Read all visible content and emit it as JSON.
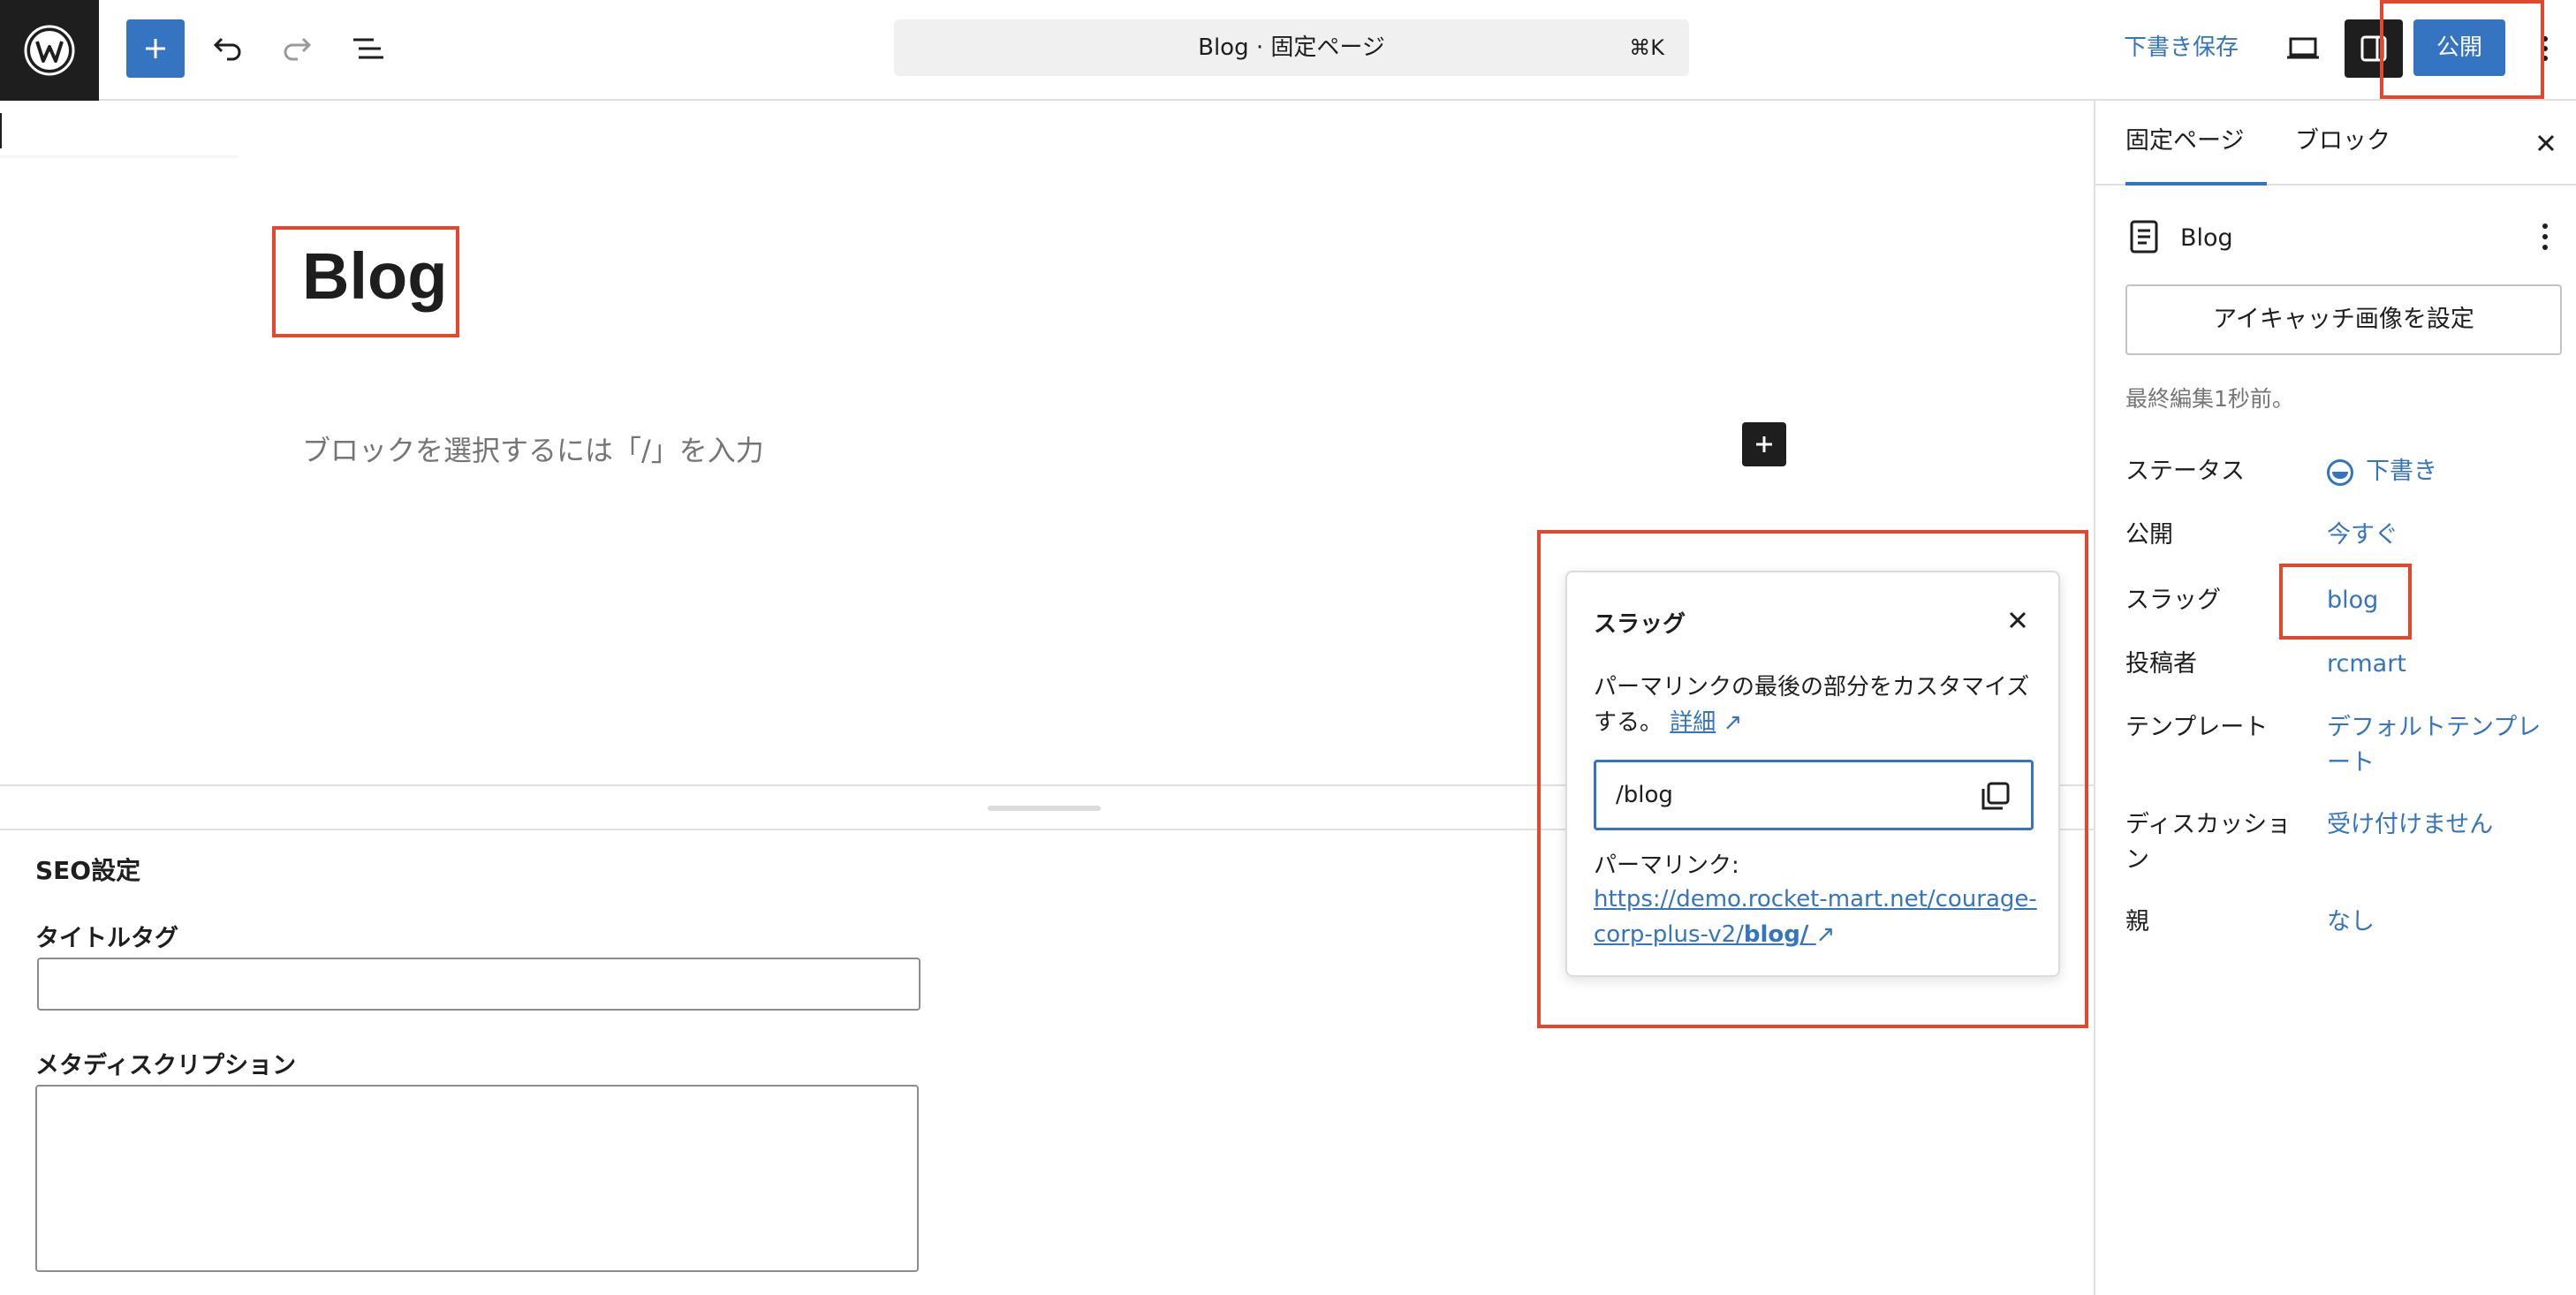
{
  "topbar": {
    "logo": "wordpress-logo",
    "icons": [
      "plus-icon",
      "undo-icon",
      "redo-icon",
      "document-overview-icon",
      "preview-icon",
      "settings-sidebar-icon",
      "more-vertical-icon"
    ],
    "document_title": "Blog · 固定ページ",
    "shortcut": "⌘K",
    "save_draft": "下書き保存",
    "publish": "公開"
  },
  "editor": {
    "title": "Blog",
    "placeholder": "ブロックを選択するには「/」を入力"
  },
  "slug_popover": {
    "title": "スラッグ",
    "description": "パーマリンクの最後の部分をカスタマイズする。",
    "learn_more": "詳細",
    "slug_value": "/blog",
    "permalink_label": "パーマリンク:",
    "permalink_base": "https://demo.rocket-mart.net/courage-corp-plus-v2/",
    "permalink_slug": "blog/"
  },
  "seo": {
    "title": "SEO設定",
    "title_tag_label": "タイトルタグ",
    "title_tag_value": "",
    "meta_description_label": "メタディスクリプション",
    "meta_description_value": ""
  },
  "sidebar": {
    "tabs": [
      {
        "label": "固定ページ",
        "active": true
      },
      {
        "label": "ブロック",
        "active": false
      }
    ],
    "doc_title": "Blog",
    "featured_image": "アイキャッチ画像を設定",
    "last_edited": "最終編集1秒前。",
    "rows": [
      {
        "label": "ステータス",
        "value": "下書き"
      },
      {
        "label": "公開",
        "value": "今すぐ"
      },
      {
        "label": "スラッグ",
        "value": "blog"
      },
      {
        "label": "投稿者",
        "value": "rcmart"
      },
      {
        "label": "テンプレート",
        "value": "デフォルトテンプレート"
      },
      {
        "label": "ディスカッション",
        "value": "受け付けません"
      },
      {
        "label": "親",
        "value": "なし"
      }
    ]
  },
  "colors": {
    "accent": "#3474c0",
    "dark": "#1e1e1e",
    "highlight": "#e2482d",
    "muted": "#757575"
  }
}
